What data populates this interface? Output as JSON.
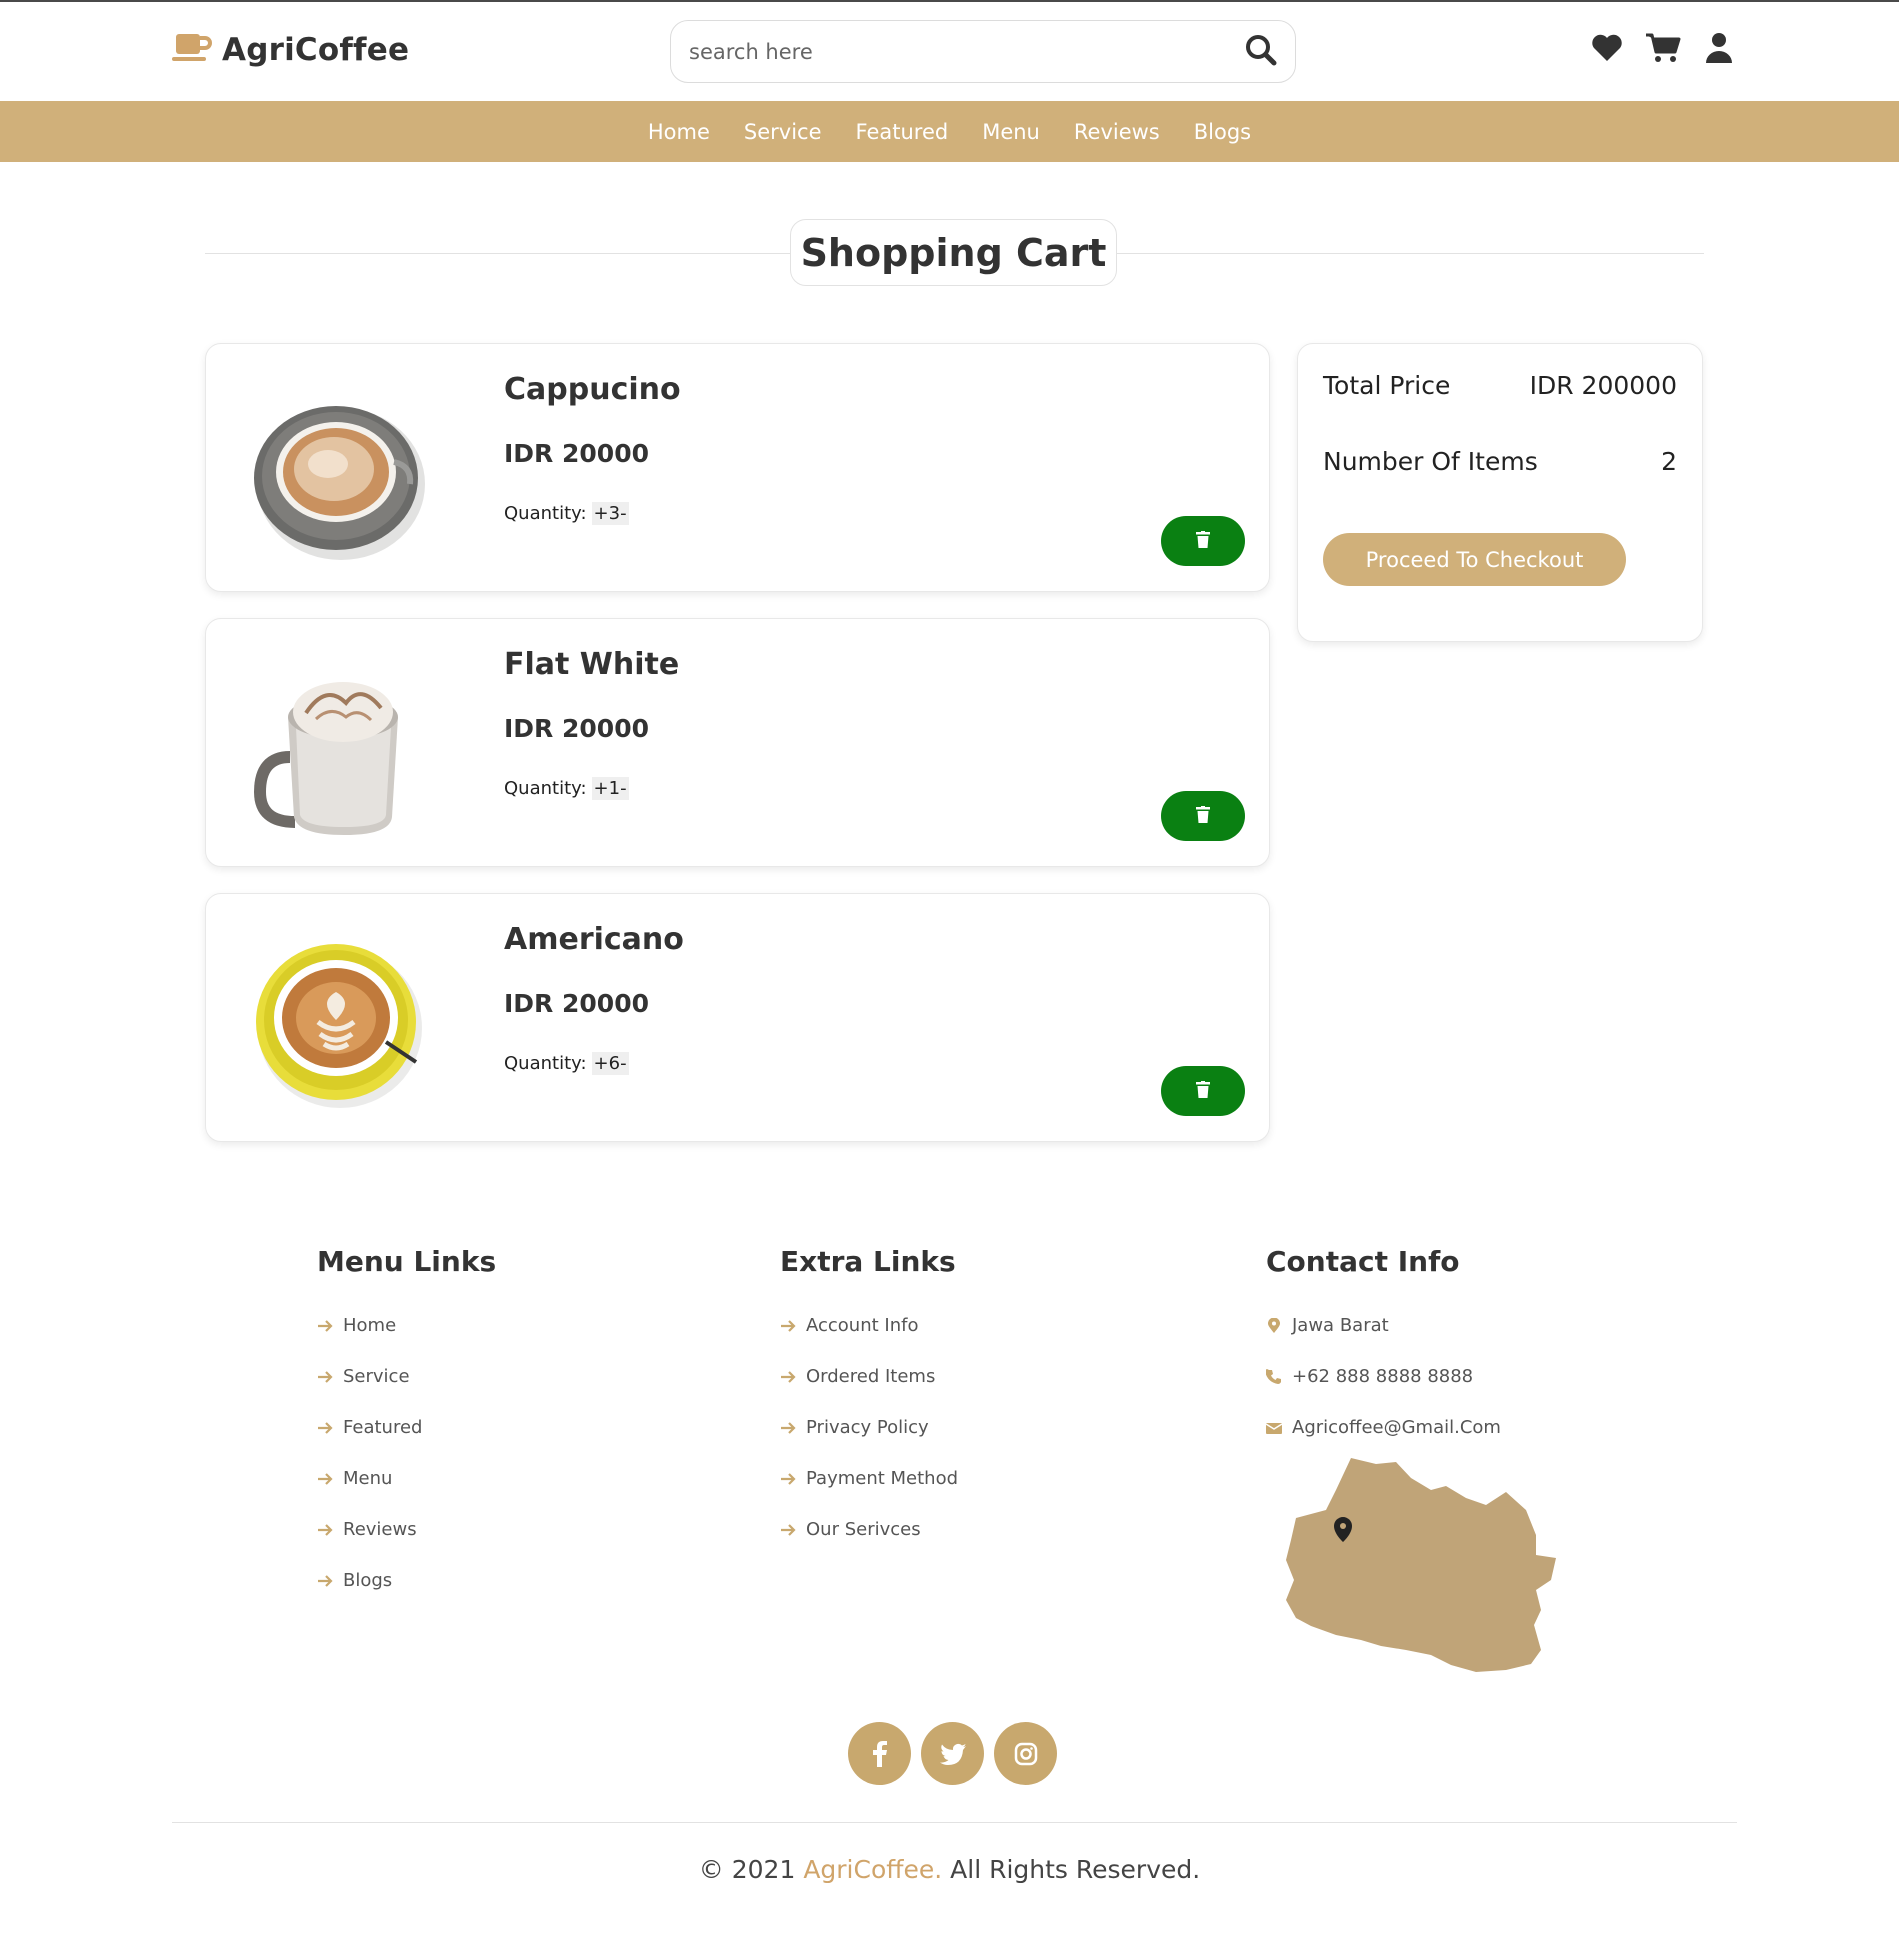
{
  "brand": {
    "name": "AgriCoffee",
    "color": "#d0b07a"
  },
  "search": {
    "placeholder": "search here"
  },
  "header_icons": [
    "heart-icon",
    "cart-icon",
    "user-icon"
  ],
  "nav": {
    "items": [
      {
        "label": "Home"
      },
      {
        "label": "Service"
      },
      {
        "label": "Featured"
      },
      {
        "label": "Menu"
      },
      {
        "label": "Reviews"
      },
      {
        "label": "Blogs"
      }
    ]
  },
  "page_title": "Shopping Cart",
  "cart": {
    "qty_label": "Quantity:",
    "items": [
      {
        "name": "Cappucino",
        "price": "IDR 20000",
        "qty": "+3-",
        "image": "cappuccino-cup"
      },
      {
        "name": "Flat White",
        "price": "IDR 20000",
        "qty": "+1-",
        "image": "flat-white-mug"
      },
      {
        "name": "Americano",
        "price": "IDR 20000",
        "qty": "+6-",
        "image": "latte-art-yellow-cup"
      }
    ],
    "delete_color": "#0a8012"
  },
  "summary": {
    "total_label": "Total Price",
    "total_value": "IDR 200000",
    "items_label": "Number Of Items",
    "items_value": "2",
    "checkout_label": "Proceed To Checkout"
  },
  "footer": {
    "menu_links": {
      "title": "Menu Links",
      "items": [
        "Home",
        "Service",
        "Featured",
        "Menu",
        "Reviews",
        "Blogs"
      ]
    },
    "extra_links": {
      "title": "Extra Links",
      "items": [
        "Account Info",
        "Ordered Items",
        "Privacy Policy",
        "Payment Method",
        "Our Serivces"
      ]
    },
    "contact": {
      "title": "Contact Info",
      "location": "Jawa Barat",
      "phone": "+62 888 8888 8888",
      "email": "Agricoffee@Gmail.Com"
    },
    "socials": [
      "facebook-icon",
      "twitter-icon",
      "instagram-icon"
    ],
    "copyright": {
      "prefix": "© 2021",
      "brand": "AgriCoffee.",
      "suffix": "All Rights Reserved."
    }
  }
}
